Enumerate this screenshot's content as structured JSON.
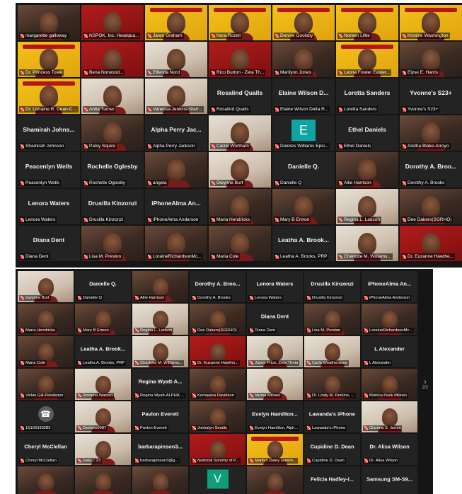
{
  "top_gallery": {
    "tiles": [
      {
        "label": "margarette galloway",
        "style": "video"
      },
      {
        "label": "NSPOK, Inc. Headqua...",
        "style": "red"
      },
      {
        "label": "Jaren Graham",
        "style": "gold"
      },
      {
        "label": "Nora Rozell",
        "style": "gold"
      },
      {
        "label": "Denine Goolsby",
        "style": "gold"
      },
      {
        "label": "Noreen Little",
        "style": "gold"
      },
      {
        "label": "Kristine Washington",
        "style": "gold"
      },
      {
        "label": "Dr. Princess Towe",
        "style": "gold"
      },
      {
        "label": "Bena Norwood...",
        "style": "red"
      },
      {
        "label": "Elfenda Nord",
        "style": "light"
      },
      {
        "label": "Rico Burton - Zeta Th...",
        "style": "red"
      },
      {
        "label": "Marilynn Jones",
        "style": "video"
      },
      {
        "label": "Leona Fowler Easter...",
        "style": "gold"
      },
      {
        "label": "Elyse E. Harris",
        "style": "video"
      },
      {
        "label": "Dr. Lorraine R. Dean-Coll...",
        "style": "gold"
      },
      {
        "label": "Anita Turner",
        "style": "light"
      },
      {
        "label": "Vanessa Jenkins-Starr...",
        "style": "light"
      },
      {
        "label": "Rosalind Qualls",
        "name": "Rosalind Qualls",
        "style": "dark"
      },
      {
        "label": "Elaine Wilson Delta R...",
        "name": "Elaine Wilson D...",
        "style": "dark"
      },
      {
        "label": "Loretta Sanders",
        "name": "Loretta Sanders",
        "style": "dark"
      },
      {
        "label": "Yvonne's S23+",
        "name": "Yvonne's S23+",
        "style": "dark"
      },
      {
        "label": "Shamirah Johnson",
        "name": "Shamirah Johns...",
        "style": "dark"
      },
      {
        "label": "Patsy Squire",
        "style": "video"
      },
      {
        "label": "Alpha Perry Jackson",
        "name": "Alpha Perry Jac...",
        "style": "dark"
      },
      {
        "label": "Carrie Wortham",
        "style": "light"
      },
      {
        "label": "Delores Williams Epsi...",
        "letter": "E",
        "style": "dark"
      },
      {
        "label": "Ethel Daniels",
        "name": "Ethel Daniels",
        "style": "dark"
      },
      {
        "label": "Aretha Blake-Arroyo",
        "style": "video"
      },
      {
        "label": "Peacenlyn Wells",
        "name": "Peacenlyn Wells",
        "style": "dark"
      },
      {
        "label": "Rochelle Oglesby",
        "name": "Rochelle Oglesby",
        "style": "dark"
      },
      {
        "label": "angela",
        "style": "video"
      },
      {
        "label": "Gwynne Burt",
        "style": "light"
      },
      {
        "label": "Danielle Q",
        "name": "Danielle Q.",
        "style": "dark"
      },
      {
        "label": "Allie Harrison",
        "style": "video"
      },
      {
        "label": "Dorothy A. Brooks",
        "name": "Dorothy A. Broo...",
        "style": "dark"
      },
      {
        "label": "Lenora Waters",
        "name": "Lenora Waters",
        "style": "dark"
      },
      {
        "label": "Drusilla Kinzonzi",
        "name": "Drusilla Kinzonzi",
        "style": "dark"
      },
      {
        "label": "iPhoneAlma Anderson",
        "name": "iPhoneAlma An...",
        "style": "dark"
      },
      {
        "label": "Maria Hendricks",
        "style": "video"
      },
      {
        "label": "Mary B Ennon",
        "style": "video"
      },
      {
        "label": "Regina L. Ladson",
        "style": "light"
      },
      {
        "label": "Dee Dakers(SGRHO)",
        "style": "video"
      },
      {
        "label": "Diana Dent",
        "name": "Diana Dent",
        "style": "dark"
      },
      {
        "label": "Lisa M. Preston",
        "style": "video"
      },
      {
        "label": "LoraineRichardsonMc...",
        "style": "video"
      },
      {
        "label": "Maria Cole",
        "style": "video"
      },
      {
        "label": "Leatha A. Brooks, PRP",
        "name": "Leatha A. Brook...",
        "style": "dark"
      },
      {
        "label": "Charlotte M. Williams...",
        "style": "light"
      },
      {
        "label": "Dr. Euzanne Hawthe...",
        "style": "red"
      }
    ]
  },
  "bottom_gallery": {
    "tiles": [
      {
        "label": "Gwynne Burt",
        "style": "light"
      },
      {
        "label": "Danielle Q",
        "name": "Danielle Q.",
        "style": "dark"
      },
      {
        "label": "Allie Harrison",
        "style": "video"
      },
      {
        "label": "Dorothy A. Brooks",
        "name": "Dorothy A. Broo...",
        "style": "dark"
      },
      {
        "label": "Lenora Waters",
        "name": "Lenora Waters",
        "style": "dark"
      },
      {
        "label": "Drusilla Kinzonzi",
        "name": "Drusilla Kinzonzi",
        "style": "dark"
      },
      {
        "label": "iPhoneAlma Anderson",
        "name": "iPhoneAlma An...",
        "style": "dark"
      },
      {
        "label": "Maria Hendricks",
        "style": "video"
      },
      {
        "label": "Mary B Ennon",
        "style": "video"
      },
      {
        "label": "Regina L. Ladson",
        "style": "light"
      },
      {
        "label": "Dee Dakers(SGRHO)",
        "style": "video"
      },
      {
        "label": "Diana Dent",
        "name": "Diana Dent",
        "style": "dark"
      },
      {
        "label": "Lisa M. Preston",
        "style": "video"
      },
      {
        "label": "LoraineRichardsonMc...",
        "style": "video"
      },
      {
        "label": "Maria Cole",
        "style": "video"
      },
      {
        "label": "Leatha A. Brooks, PRP",
        "name": "Leatha A. Brook...",
        "style": "dark"
      },
      {
        "label": "Charlotte M. Williams...",
        "style": "light"
      },
      {
        "label": "Dr. Euzanne Hawtho...",
        "style": "red"
      },
      {
        "label": "Jayne Price, Zeta Theta",
        "style": "light"
      },
      {
        "label": "Carla Weathersbee",
        "style": "light"
      },
      {
        "label": "L Alexander",
        "name": "L Alexander",
        "style": "dark"
      },
      {
        "label": "Vickie Gill-Pendleton",
        "style": "video"
      },
      {
        "label": "Rowena Watson",
        "style": "light"
      },
      {
        "label": "Regina Wyatt-ALPHA ...",
        "name": "Regina Wyatt-A...",
        "style": "dark"
      },
      {
        "label": "Kemaalea Davidson",
        "style": "video"
      },
      {
        "label": "Varina Milines",
        "style": "light"
      },
      {
        "label": "Dr. Lindy M. Perkins, ...",
        "style": "video"
      },
      {
        "label": "Monica Peek Milines",
        "style": "video"
      },
      {
        "label": "15106333289",
        "phone": true,
        "style": "dark"
      },
      {
        "label": "Deebee0987",
        "style": "light"
      },
      {
        "label": "Pavlon Everett",
        "name": "Pavlon Everett",
        "style": "dark"
      },
      {
        "label": "Joshalyn Smalls",
        "style": "video"
      },
      {
        "label": "Evelyn Hamilton, Alph...",
        "name": "Evelyn Hamilton...",
        "style": "dark"
      },
      {
        "label": "Lawanda's iPhone",
        "name": "Lawanda's iPhone",
        "style": "dark"
      },
      {
        "label": "Clarena S. Jones",
        "style": "light"
      },
      {
        "label": "Cheryl McClellan",
        "name": "Cheryl McClellan",
        "style": "dark"
      },
      {
        "label": "Gala... 23",
        "style": "light"
      },
      {
        "label": "barbarapinson3@g...",
        "name": "barbarapinson3...",
        "style": "dark"
      },
      {
        "label": "National Sorority of P...",
        "style": "red"
      },
      {
        "label": "Marilyn Daley Gamm...",
        "style": "gold"
      },
      {
        "label": "Cupidine D. Dean",
        "name": "Cupidine D. Dean",
        "style": "dark"
      },
      {
        "label": "Dr. Alisa Wilson",
        "name": "Dr. Alisa Wilson",
        "style": "dark"
      },
      {
        "label": "",
        "style": "video"
      },
      {
        "label": "",
        "style": "video"
      },
      {
        "label": "",
        "style": "video"
      },
      {
        "label": "",
        "letter": "V",
        "letter_color": "green",
        "style": "dark"
      },
      {
        "label": "",
        "style": "video"
      },
      {
        "label": "",
        "name": "Felicia Hadley-i...",
        "style": "dark"
      },
      {
        "label": "",
        "name": "Samsung SM-S9...",
        "style": "dark"
      }
    ]
  },
  "pager": {
    "arrow": "›",
    "page": "2/2"
  },
  "colors": {
    "background": "#151515",
    "tile": "#232323",
    "gold": "#f3c21a",
    "red": "#b21c1c",
    "muted_mic": "#e53935"
  }
}
